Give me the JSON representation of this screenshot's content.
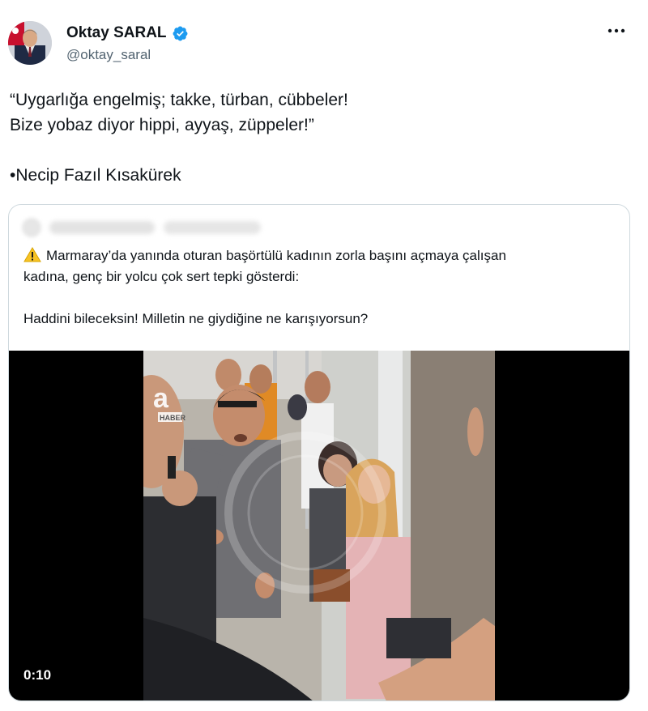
{
  "author": {
    "name": "Oktay SARAL",
    "handle": "@oktay_saral",
    "verified": true
  },
  "tweet": {
    "lines": [
      "“Uygarlığa engelmiş; takke, türban, cübbeler!",
      "Bize yobaz diyor hippi, ayyaş, züppeler!”",
      "",
      "•Necip Fazıl Kısakürek"
    ]
  },
  "quote": {
    "text_line1": "Marmaray’da yanında oturan başörtülü kadının zorla başını açmaya çalışan",
    "text_line2": "kadına, genç bir yolcu çok sert tepki gösterdi:",
    "text_line3": "Haddini bileceksin! Milletin ne giydiğine ne karışıyorsun?",
    "video": {
      "duration": "0:10",
      "watermark_logo": "a HABER"
    }
  },
  "icons": {
    "more": "more-horizontal-icon",
    "verified": "verified-badge-icon",
    "warning": "warning-icon"
  },
  "colors": {
    "verified_blue": "#1d9bf0",
    "secondary_text": "#536471",
    "border": "#cfd9de",
    "warning_yellow": "#f7c325"
  }
}
